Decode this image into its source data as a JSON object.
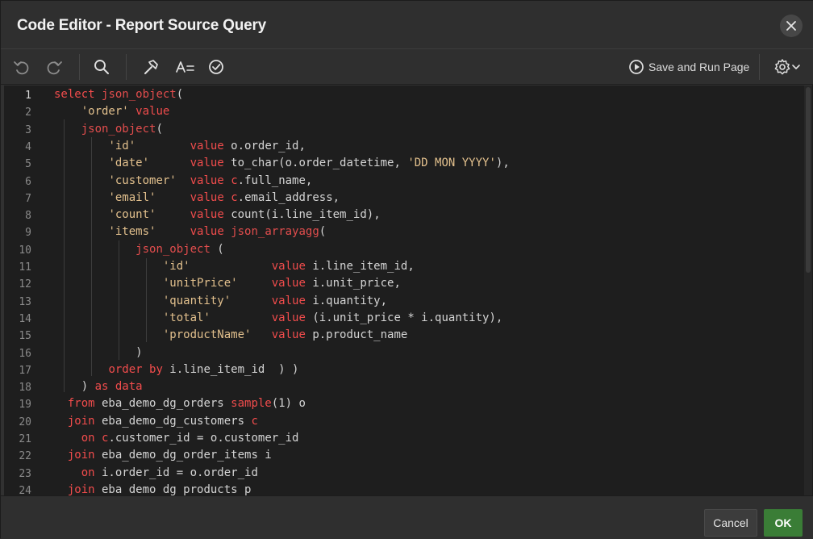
{
  "dialog": {
    "title": "Code Editor - Report Source Query"
  },
  "toolbar": {
    "icons": [
      "undo-icon",
      "redo-icon",
      "search-icon",
      "hammer-icon",
      "autocomplete-icon",
      "validate-icon",
      "settings-icon"
    ],
    "save_run_label": "Save and Run Page"
  },
  "editor": {
    "active_line": 1,
    "line_numbers": [
      "1",
      "2",
      "3",
      "4",
      "5",
      "6",
      "7",
      "8",
      "9",
      "10",
      "11",
      "12",
      "13",
      "14",
      "15",
      "16",
      "17",
      "18",
      "19",
      "20",
      "21",
      "22",
      "23",
      "24"
    ],
    "lines": [
      [
        [
          "kw",
          "select "
        ],
        [
          "fn",
          "json_object"
        ],
        [
          "t",
          "("
        ]
      ],
      [
        [
          "t",
          "    "
        ],
        [
          "str",
          "'order'"
        ],
        [
          "t",
          " "
        ],
        [
          "kw",
          "value"
        ]
      ],
      [
        [
          "t",
          "    "
        ],
        [
          "fn",
          "json_object"
        ],
        [
          "t",
          "("
        ]
      ],
      [
        [
          "t",
          "        "
        ],
        [
          "str",
          "'id'"
        ],
        [
          "t",
          "        "
        ],
        [
          "kw",
          "value"
        ],
        [
          "t",
          " o.order_id,"
        ]
      ],
      [
        [
          "t",
          "        "
        ],
        [
          "str",
          "'date'"
        ],
        [
          "t",
          "      "
        ],
        [
          "kw",
          "value"
        ],
        [
          "t",
          " to_char(o.order_datetime, "
        ],
        [
          "str",
          "'DD MON YYYY'"
        ],
        [
          "t",
          "),"
        ]
      ],
      [
        [
          "t",
          "        "
        ],
        [
          "str",
          "'customer'"
        ],
        [
          "t",
          "  "
        ],
        [
          "kw",
          "value"
        ],
        [
          "t",
          " "
        ],
        [
          "kw",
          "c"
        ],
        [
          "t",
          ".full_name,"
        ]
      ],
      [
        [
          "t",
          "        "
        ],
        [
          "str",
          "'email'"
        ],
        [
          "t",
          "     "
        ],
        [
          "kw",
          "value"
        ],
        [
          "t",
          " "
        ],
        [
          "kw",
          "c"
        ],
        [
          "t",
          ".email_address,"
        ]
      ],
      [
        [
          "t",
          "        "
        ],
        [
          "str",
          "'count'"
        ],
        [
          "t",
          "     "
        ],
        [
          "kw",
          "value"
        ],
        [
          "t",
          " count(i.line_item_id),"
        ]
      ],
      [
        [
          "t",
          "        "
        ],
        [
          "str",
          "'items'"
        ],
        [
          "t",
          "     "
        ],
        [
          "kw",
          "value"
        ],
        [
          "t",
          " "
        ],
        [
          "fn",
          "json_arrayagg"
        ],
        [
          "t",
          "("
        ]
      ],
      [
        [
          "t",
          "            "
        ],
        [
          "fn",
          "json_object"
        ],
        [
          "t",
          " ("
        ]
      ],
      [
        [
          "t",
          "                "
        ],
        [
          "str",
          "'id'"
        ],
        [
          "t",
          "            "
        ],
        [
          "kw",
          "value"
        ],
        [
          "t",
          " i.line_item_id,"
        ]
      ],
      [
        [
          "t",
          "                "
        ],
        [
          "str",
          "'unitPrice'"
        ],
        [
          "t",
          "     "
        ],
        [
          "kw",
          "value"
        ],
        [
          "t",
          " i.unit_price,"
        ]
      ],
      [
        [
          "t",
          "                "
        ],
        [
          "str",
          "'quantity'"
        ],
        [
          "t",
          "      "
        ],
        [
          "kw",
          "value"
        ],
        [
          "t",
          " i.quantity,"
        ]
      ],
      [
        [
          "t",
          "                "
        ],
        [
          "str",
          "'total'"
        ],
        [
          "t",
          "         "
        ],
        [
          "kw",
          "value"
        ],
        [
          "t",
          " (i.unit_price * i.quantity),"
        ]
      ],
      [
        [
          "t",
          "                "
        ],
        [
          "str",
          "'productName'"
        ],
        [
          "t",
          "   "
        ],
        [
          "kw",
          "value"
        ],
        [
          "t",
          " p.product_name"
        ]
      ],
      [
        [
          "t",
          "            )"
        ]
      ],
      [
        [
          "t",
          "        "
        ],
        [
          "kw",
          "order by"
        ],
        [
          "t",
          " i.line_item_id  ) )"
        ]
      ],
      [
        [
          "t",
          "    ) "
        ],
        [
          "kw",
          "as data"
        ]
      ],
      [
        [
          "t",
          "  "
        ],
        [
          "kw",
          "from"
        ],
        [
          "t",
          " eba_demo_dg_orders "
        ],
        [
          "kw",
          "sample"
        ],
        [
          "t",
          "(1) o"
        ]
      ],
      [
        [
          "t",
          "  "
        ],
        [
          "kw",
          "join"
        ],
        [
          "t",
          " eba_demo_dg_customers "
        ],
        [
          "kw",
          "c"
        ]
      ],
      [
        [
          "t",
          "    "
        ],
        [
          "kw",
          "on"
        ],
        [
          "t",
          " "
        ],
        [
          "kw",
          "c"
        ],
        [
          "t",
          ".customer_id = o.customer_id"
        ]
      ],
      [
        [
          "t",
          "  "
        ],
        [
          "kw",
          "join"
        ],
        [
          "t",
          " eba_demo_dg_order_items i"
        ]
      ],
      [
        [
          "t",
          "    "
        ],
        [
          "kw",
          "on"
        ],
        [
          "t",
          " i.order_id = o.order_id"
        ]
      ],
      [
        [
          "t",
          "  "
        ],
        [
          "kw",
          "join"
        ],
        [
          "t",
          " eba_demo_dg_products p"
        ]
      ]
    ]
  },
  "footer": {
    "cancel_label": "Cancel",
    "ok_label": "OK"
  },
  "colors": {
    "keyword": "#f14c4c",
    "string": "#e2c08d",
    "plain": "#d4d4d4",
    "ok_button": "#3a7d36",
    "editor_bg": "#1e1e1e"
  }
}
